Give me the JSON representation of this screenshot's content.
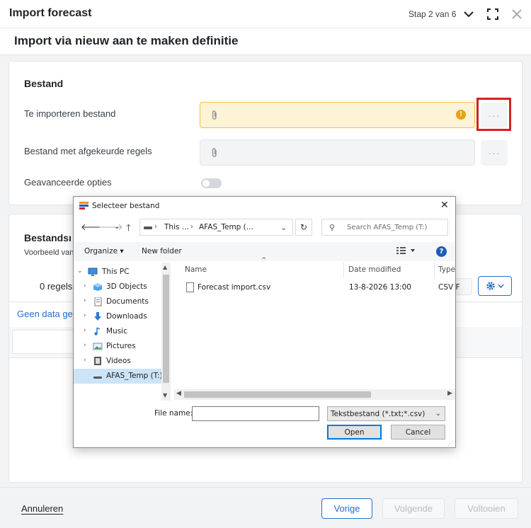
{
  "header": {
    "title": "Import forecast",
    "step": "Stap 2 van 6",
    "icons": [
      "chevron-down-icon",
      "expand-icon",
      "close-icon"
    ]
  },
  "subheader": {
    "title": "Import via nieuw aan te maken definitie"
  },
  "bestand": {
    "section_title": "Bestand",
    "import_file_label": "Te importeren bestand",
    "rejected_file_label": "Bestand met afgekeurde regels",
    "advanced_label": "Geavanceerde opties",
    "browse_label": "···",
    "warning_symbol": "!"
  },
  "bestandsinfo": {
    "section_title_partial": "Bestandsı",
    "example_partial": "Voorbeeld van",
    "rows_partial": "0 regels",
    "nodata_partial": "Geen data ge"
  },
  "footer": {
    "cancel": "Annuleren",
    "previous": "Vorige",
    "next": "Volgende",
    "finish": "Voltooien"
  },
  "dialog": {
    "title": "Selecteer bestand",
    "close": "✕",
    "address": {
      "seg1": "This ...",
      "seg2": "AFAS_Temp (...",
      "sep": "›"
    },
    "search_placeholder": "Search AFAS_Temp (T:)",
    "toolbar": {
      "organize": "Organize ▾",
      "new_folder": "New folder",
      "help": "?"
    },
    "tree": [
      {
        "label": "This PC",
        "icon": "pc-icon",
        "expander": "⌄"
      },
      {
        "label": "3D Objects",
        "icon": "3d-objects-icon",
        "expander": "›"
      },
      {
        "label": "Documents",
        "icon": "documents-icon",
        "expander": "›"
      },
      {
        "label": "Downloads",
        "icon": "downloads-icon",
        "expander": "›"
      },
      {
        "label": "Music",
        "icon": "music-icon",
        "expander": "›"
      },
      {
        "label": "Pictures",
        "icon": "pictures-icon",
        "expander": "›"
      },
      {
        "label": "Videos",
        "icon": "videos-icon",
        "expander": "›"
      },
      {
        "label": "AFAS_Temp (T:)",
        "icon": "drive-icon",
        "expander": ""
      }
    ],
    "columns": {
      "name": "Name",
      "date": "Date modified",
      "type": "Type"
    },
    "files": [
      {
        "name": "Forecast import.csv",
        "date": "13-8-2026 13:00",
        "type": "CSV F"
      }
    ],
    "filename_label": "File name:",
    "filename_value": "",
    "filetype_value": "Tekstbestand (*.txt;*.csv)",
    "open": "Open",
    "cancel": "Cancel"
  },
  "colors": {
    "accent": "#2a6fc9",
    "warning_fill": "#fdf3d6",
    "warning_border": "#f0c040",
    "highlight": "#d62020",
    "selection": "#cce4f7"
  }
}
